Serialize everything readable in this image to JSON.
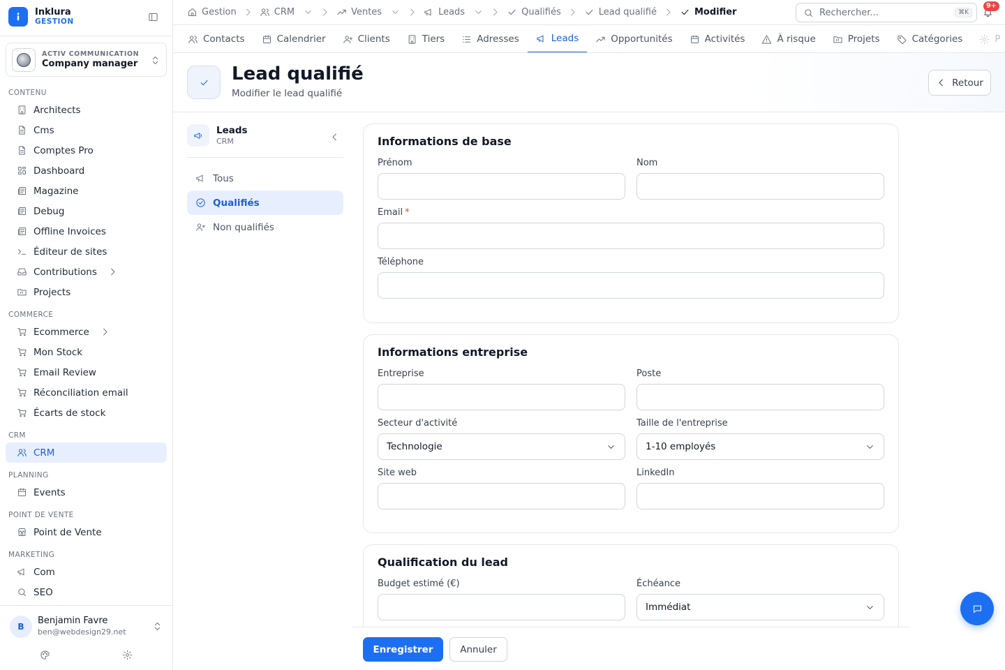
{
  "app": {
    "name": "Inklura",
    "module": "GESTION"
  },
  "org": {
    "label": "ACTIV COMMUNICATION",
    "role": "Company manager"
  },
  "sidebar": {
    "sections": [
      {
        "title": "CONTENU",
        "items": [
          {
            "label": "Architects",
            "icon": "building-icon"
          },
          {
            "label": "Cms",
            "icon": "file-icon"
          },
          {
            "label": "Comptes Pro",
            "icon": "file-icon"
          },
          {
            "label": "Dashboard",
            "icon": "grid-icon"
          },
          {
            "label": "Magazine",
            "icon": "newspaper-icon"
          },
          {
            "label": "Debug",
            "icon": "newspaper-icon"
          },
          {
            "label": "Offline Invoices",
            "icon": "newspaper-icon"
          },
          {
            "label": "Éditeur de sites",
            "icon": "terminal-icon"
          },
          {
            "label": "Contributions",
            "icon": "inbox-icon",
            "chevron": true
          },
          {
            "label": "Projects",
            "icon": "folder-icon"
          }
        ]
      },
      {
        "title": "COMMERCE",
        "items": [
          {
            "label": "Ecommerce",
            "icon": "cart-icon",
            "chevron": true
          },
          {
            "label": "Mon Stock",
            "icon": "cart-icon"
          },
          {
            "label": "Email Review",
            "icon": "cart-icon"
          },
          {
            "label": "Réconciliation email",
            "icon": "cart-icon"
          },
          {
            "label": "Écarts de stock",
            "icon": "cart-icon"
          }
        ]
      },
      {
        "title": "CRM",
        "items": [
          {
            "label": "CRM",
            "icon": "users-icon",
            "active": true
          }
        ]
      },
      {
        "title": "PLANNING",
        "items": [
          {
            "label": "Events",
            "icon": "calendar-icon"
          }
        ]
      },
      {
        "title": "POINT DE VENTE",
        "items": [
          {
            "label": "Point de Vente",
            "icon": "store-icon"
          }
        ]
      },
      {
        "title": "MARKETING",
        "items": [
          {
            "label": "Com",
            "icon": "megaphone-icon"
          },
          {
            "label": "SEO",
            "icon": "search-icon"
          }
        ]
      }
    ]
  },
  "user": {
    "initial": "B",
    "name": "Benjamin Favre",
    "email": "ben@webdesign29.net"
  },
  "breadcrumb": [
    {
      "label": "Gestion",
      "icon": "home-icon"
    },
    {
      "label": "CRM",
      "icon": "users-icon",
      "dropdown": true
    },
    {
      "label": "Ventes",
      "icon": "trend-icon",
      "dropdown": true
    },
    {
      "label": "Leads",
      "icon": "megaphone-icon",
      "dropdown": true
    },
    {
      "label": "Qualifiés",
      "icon": "check-icon"
    },
    {
      "label": "Lead qualifié",
      "icon": "check-icon"
    },
    {
      "label": "Modifier",
      "icon": "check-icon",
      "current": true
    }
  ],
  "search": {
    "placeholder": "Rechercher...",
    "shortcut": "⌘K"
  },
  "notifications": {
    "count": "9+"
  },
  "tabs": [
    {
      "label": "Contacts",
      "icon": "users-icon"
    },
    {
      "label": "Calendrier",
      "icon": "calendar-icon"
    },
    {
      "label": "Clients",
      "icon": "user-plus-icon"
    },
    {
      "label": "Tiers",
      "icon": "building-icon"
    },
    {
      "label": "Adresses",
      "icon": "list-icon"
    },
    {
      "label": "Leads",
      "icon": "megaphone-icon",
      "active": true
    },
    {
      "label": "Opportunités",
      "icon": "trend-icon"
    },
    {
      "label": "Activités",
      "icon": "calendar-icon"
    },
    {
      "label": "À risque",
      "icon": "warning-icon"
    },
    {
      "label": "Projets",
      "icon": "folder-icon"
    },
    {
      "label": "Catégories",
      "icon": "tag-icon"
    },
    {
      "label": "P",
      "icon": "gear-icon"
    }
  ],
  "page": {
    "title": "Lead qualifié",
    "subtitle": "Modifier le lead qualifié",
    "back_label": "Retour"
  },
  "subnav": {
    "title": "Leads",
    "subtitle": "CRM",
    "items": [
      {
        "label": "Tous",
        "icon": "megaphone-icon"
      },
      {
        "label": "Qualifiés",
        "icon": "check-circle-icon",
        "active": true
      },
      {
        "label": "Non qualifiés",
        "icon": "user-x-icon"
      }
    ]
  },
  "form": {
    "basic": {
      "title": "Informations de base",
      "first_name": {
        "label": "Prénom",
        "value": ""
      },
      "last_name": {
        "label": "Nom",
        "value": ""
      },
      "email": {
        "label": "Email",
        "required": "*",
        "value": ""
      },
      "phone": {
        "label": "Téléphone",
        "value": ""
      }
    },
    "company": {
      "title": "Informations entreprise",
      "company": {
        "label": "Entreprise",
        "value": ""
      },
      "position": {
        "label": "Poste",
        "value": ""
      },
      "sector": {
        "label": "Secteur d'activité",
        "value": "Technologie"
      },
      "size": {
        "label": "Taille de l'entreprise",
        "value": "1-10 employés"
      },
      "website": {
        "label": "Site web",
        "value": ""
      },
      "linkedin": {
        "label": "LinkedIn",
        "value": ""
      }
    },
    "qualification": {
      "title": "Qualification du lead",
      "budget": {
        "label": "Budget estimé (€)",
        "value": ""
      },
      "deadline": {
        "label": "Échéance",
        "value": "Immédiat"
      }
    }
  },
  "actions": {
    "save_label": "Enregistrer",
    "cancel_label": "Annuler"
  },
  "colors": {
    "accent": "#1d6ff2",
    "active_bg": "#e7efff",
    "danger": "#ef4444"
  }
}
